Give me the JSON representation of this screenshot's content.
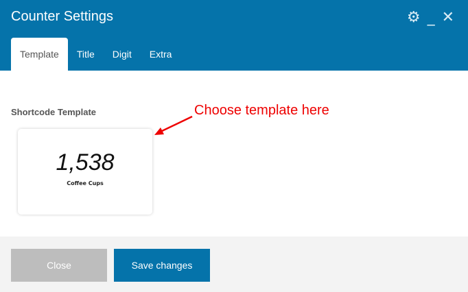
{
  "header": {
    "title": "Counter Settings",
    "icons": [
      "gear-icon",
      "minimize-icon",
      "close-icon"
    ]
  },
  "tabs": [
    {
      "label": "Template",
      "active": true
    },
    {
      "label": "Title"
    },
    {
      "label": "Digit"
    },
    {
      "label": "Extra"
    }
  ],
  "main": {
    "label": "Shortcode Template",
    "template": {
      "number": "1,538",
      "caption": "Coffee Cups"
    },
    "annotation": "Choose template here",
    "annotation_color": "#e00000"
  },
  "footer": {
    "close_label": "Close",
    "save_label": "Save changes"
  },
  "colors": {
    "brand": "#0573aa",
    "disabled": "#bdbdbd"
  }
}
